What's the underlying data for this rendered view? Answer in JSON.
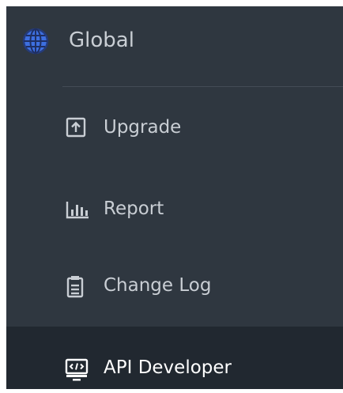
{
  "sidebar": {
    "header": {
      "title": "Global",
      "icon": "globe-icon",
      "icon_color": "#3d6fe0"
    },
    "items": [
      {
        "label": "Upgrade",
        "icon": "upload-box-icon",
        "active": false
      },
      {
        "label": "Report",
        "icon": "bar-chart-icon",
        "active": false
      },
      {
        "label": "Change Log",
        "icon": "clipboard-icon",
        "active": false
      },
      {
        "label": "API Developer",
        "icon": "code-monitor-icon",
        "active": true
      }
    ],
    "colors": {
      "background": "#2f3740",
      "active_background": "#212830",
      "text": "#c9ced4",
      "active_text": "#ffffff"
    }
  }
}
